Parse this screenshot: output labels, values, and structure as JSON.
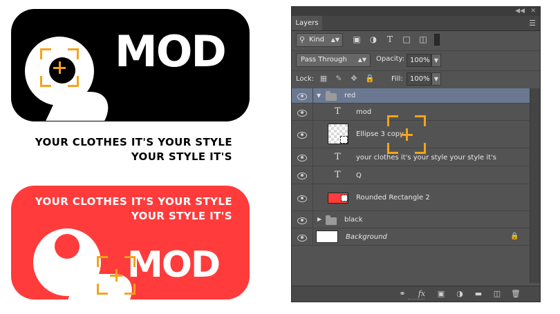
{
  "artwork": {
    "logo_black": {
      "letter_mark": "Q",
      "brand": "MOD"
    },
    "tagline_black": {
      "line1": "YOUR CLOTHES IT'S YOUR STYLE",
      "line2": "YOUR STYLE IT'S"
    },
    "logo_red": {
      "letter_mark": "Q",
      "brand": "MOD",
      "line1": "YOUR CLOTHES IT'S YOUR STYLE",
      "line2": "YOUR STYLE IT'S"
    },
    "colors": {
      "black": "#000000",
      "red": "#ff3b3b",
      "marquee": "#f5a31a",
      "tagline": "#000000"
    }
  },
  "panel": {
    "title_tab": "Layers",
    "collapse_icon": "double-chevron-left-icon",
    "close_icon": "close-icon",
    "menu_icon": "panel-menu-icon",
    "filter": {
      "kind_label": "Kind",
      "icons": [
        "pixel-filter-icon",
        "adjustment-filter-icon",
        "type-filter-icon",
        "shape-filter-icon",
        "smart-object-filter-icon"
      ]
    },
    "blend_mode": "Pass Through",
    "opacity_label": "Opacity:",
    "opacity_value": "100%",
    "lock_label": "Lock:",
    "fill_label": "Fill:",
    "fill_value": "100%",
    "lock_icons": [
      "lock-transparent-icon",
      "lock-image-icon",
      "lock-position-icon",
      "lock-all-icon"
    ],
    "layers": [
      {
        "name": "red",
        "kind": "group",
        "expanded": true,
        "selected": true
      },
      {
        "name": "mod",
        "kind": "type"
      },
      {
        "name": "Ellipse 3 copy",
        "kind": "shape"
      },
      {
        "name": "your clothes it's your style your style it's",
        "kind": "type"
      },
      {
        "name": "Q",
        "kind": "type"
      },
      {
        "name": "Rounded Rectangle 2",
        "kind": "shape"
      },
      {
        "name": "black",
        "kind": "group",
        "expanded": false
      },
      {
        "name": "Background",
        "kind": "background",
        "locked": true
      }
    ],
    "bottom_icons": [
      "link-layers-icon",
      "fx-icon",
      "add-mask-icon",
      "adjustment-layer-icon",
      "new-group-icon",
      "new-layer-icon",
      "trash-icon"
    ],
    "fx_label": "fx"
  }
}
